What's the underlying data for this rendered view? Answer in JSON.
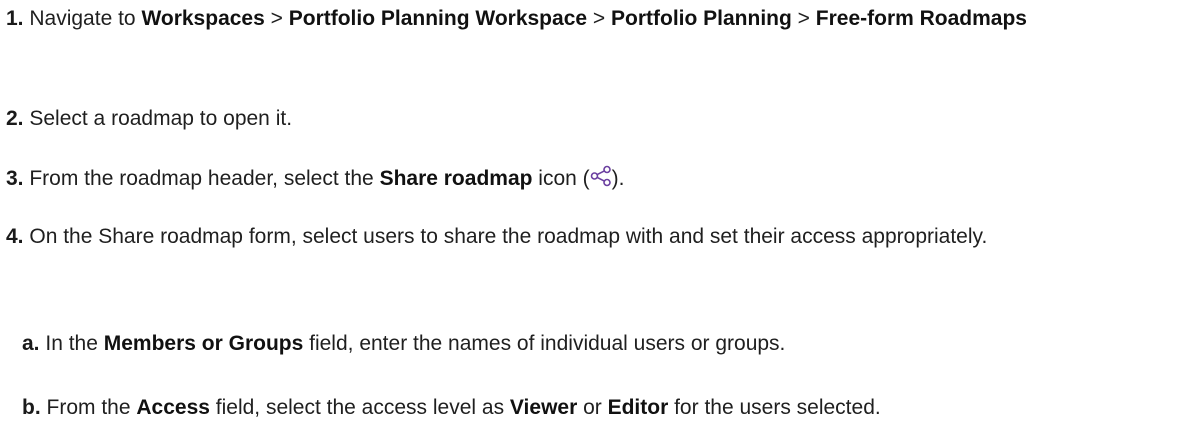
{
  "steps": [
    {
      "num": "1.",
      "t0": "Navigate to ",
      "b0": "Workspaces",
      "t1": " > ",
      "b1": "Portfolio Planning Workspace",
      "t2": " > ",
      "b2": "Portfolio Planning",
      "t3": " > ",
      "b3": "Free-form Roadmaps"
    },
    {
      "num": "2.",
      "t0": "Select a roadmap to open it."
    },
    {
      "num": "3.",
      "t0": "From the roadmap header, select the ",
      "b0": "Share roadmap",
      "t1": " icon (",
      "icon": "share-icon",
      "t2": ")."
    },
    {
      "num": "4.",
      "t0": "On the Share roadmap form, select users to share the roadmap with and set their access appropriately."
    }
  ],
  "substeps": [
    {
      "num": "a.",
      "t0": "In the ",
      "b0": "Members or Groups",
      "t1": " field, enter the names of individual users or groups."
    },
    {
      "num": "b.",
      "t0": "From the ",
      "b0": "Access",
      "t1": " field, select the access level as ",
      "b1": "Viewer",
      "t2": " or ",
      "b2": "Editor",
      "t3": " for the users selected."
    }
  ],
  "colors": {
    "text": "#1f1f1f",
    "icon": "#6b3fa0"
  }
}
